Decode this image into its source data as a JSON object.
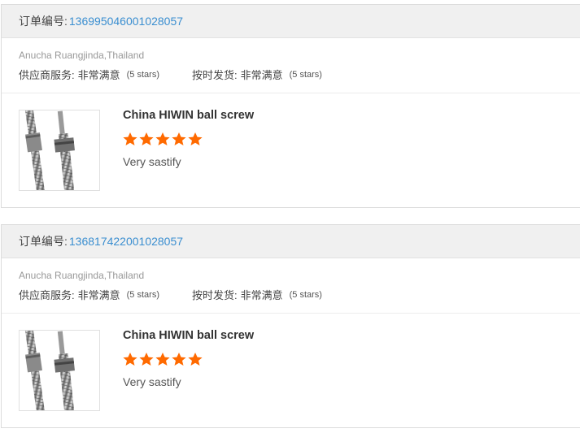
{
  "orders": [
    {
      "order_label": "订单编号:",
      "order_number": "136995046001028057",
      "buyer": "Anucha Ruangjinda,Thailand",
      "service_label": "供应商服务:",
      "service_value": "非常满意",
      "service_stars": "(5 stars)",
      "delivery_label": "按时发货:",
      "delivery_value": "非常满意",
      "delivery_stars": "(5 stars)",
      "product_title": "China HIWIN ball screw",
      "rating": 5,
      "review": "Very sastify"
    },
    {
      "order_label": "订单编号:",
      "order_number": "136817422001028057",
      "buyer": "Anucha Ruangjinda,Thailand",
      "service_label": "供应商服务:",
      "service_value": "非常满意",
      "service_stars": "(5 stars)",
      "delivery_label": "按时发货:",
      "delivery_value": "非常满意",
      "delivery_stars": "(5 stars)",
      "product_title": "China HIWIN ball screw",
      "rating": 5,
      "review": "Very sastify"
    }
  ],
  "colors": {
    "star": "#ff6a00",
    "link": "#3a8ed0"
  }
}
